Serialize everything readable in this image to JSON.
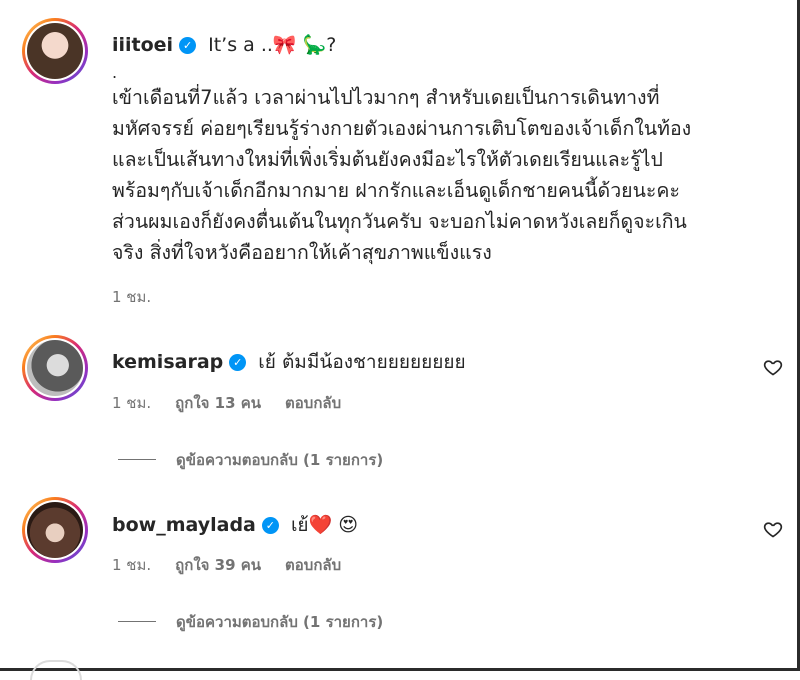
{
  "post": {
    "username": "iiitoei",
    "caption_head": "It’s a ..🎀 🦕?",
    "dot": ".",
    "body_lines": [
      "เข้าเดือนที่7แล้ว เวลาผ่านไปไวมากๆ สำหรับเดยเป็นการเดินทางที่",
      "มหัศจรรย์ ค่อยๆเรียนรู้ร่างกายตัวเองผ่านการเติบโตของเจ้าเด็กในท้อง",
      "และเป็นเส้นทางใหม่ที่เพิ่งเริ่มต้นยังคงมีอะไรให้ตัวเดยเรียนและรู้ไป",
      "พร้อมๆกับเจ้าเด็กอีกมากมาย ฝากรักและเอ็นดูเด็กชายคนนี้ด้วยนะคะ",
      "ส่วนผมเองก็ยังคงตื่นเต้นในทุกวันครับ จะบอกไม่คาดหวังเลยก็ดูจะเกิน",
      "จริง สิ่งที่ใจหวังคืออยากให้เค้าสุขภาพแข็งแรง"
    ],
    "time": "1 ชม."
  },
  "comments": [
    {
      "username": "kemisarap",
      "text": "เย้ ต้มมีน้องชายยยยยยยย",
      "time": "1 ชม.",
      "likes": "ถูกใจ 13 คน",
      "reply": "ตอบกลับ",
      "view_replies": "ดูข้อความตอบกลับ (1 รายการ)"
    },
    {
      "username": "bow_maylada",
      "text": "เย้❤️ 😍",
      "time": "1 ชม.",
      "likes": "ถูกใจ 39 คน",
      "reply": "ตอบกลับ",
      "view_replies": "ดูข้อความตอบกลับ (1 รายการ)"
    }
  ],
  "icons": {
    "verified": "verified-badge-icon",
    "like": "heart-outline-icon"
  },
  "colors": {
    "verified": "#0095f6",
    "muted": "#737373",
    "text": "#262626"
  }
}
